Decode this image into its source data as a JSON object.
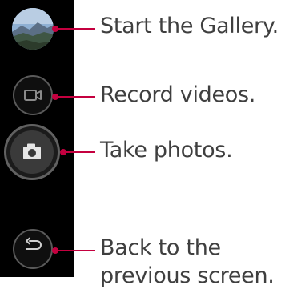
{
  "callouts": {
    "gallery": "Start the Gallery.",
    "record": "Record videos.",
    "photo": "Take photos.",
    "back_line1": "Back to the",
    "back_line2": "previous screen."
  },
  "icons": {
    "gallery": "gallery-thumbnail",
    "record": "video-camera-icon",
    "photo": "camera-icon",
    "back": "back-arrow-icon"
  },
  "colors": {
    "leader": "#c4003f",
    "strip": "#000000",
    "text": "#3f3f3f"
  }
}
